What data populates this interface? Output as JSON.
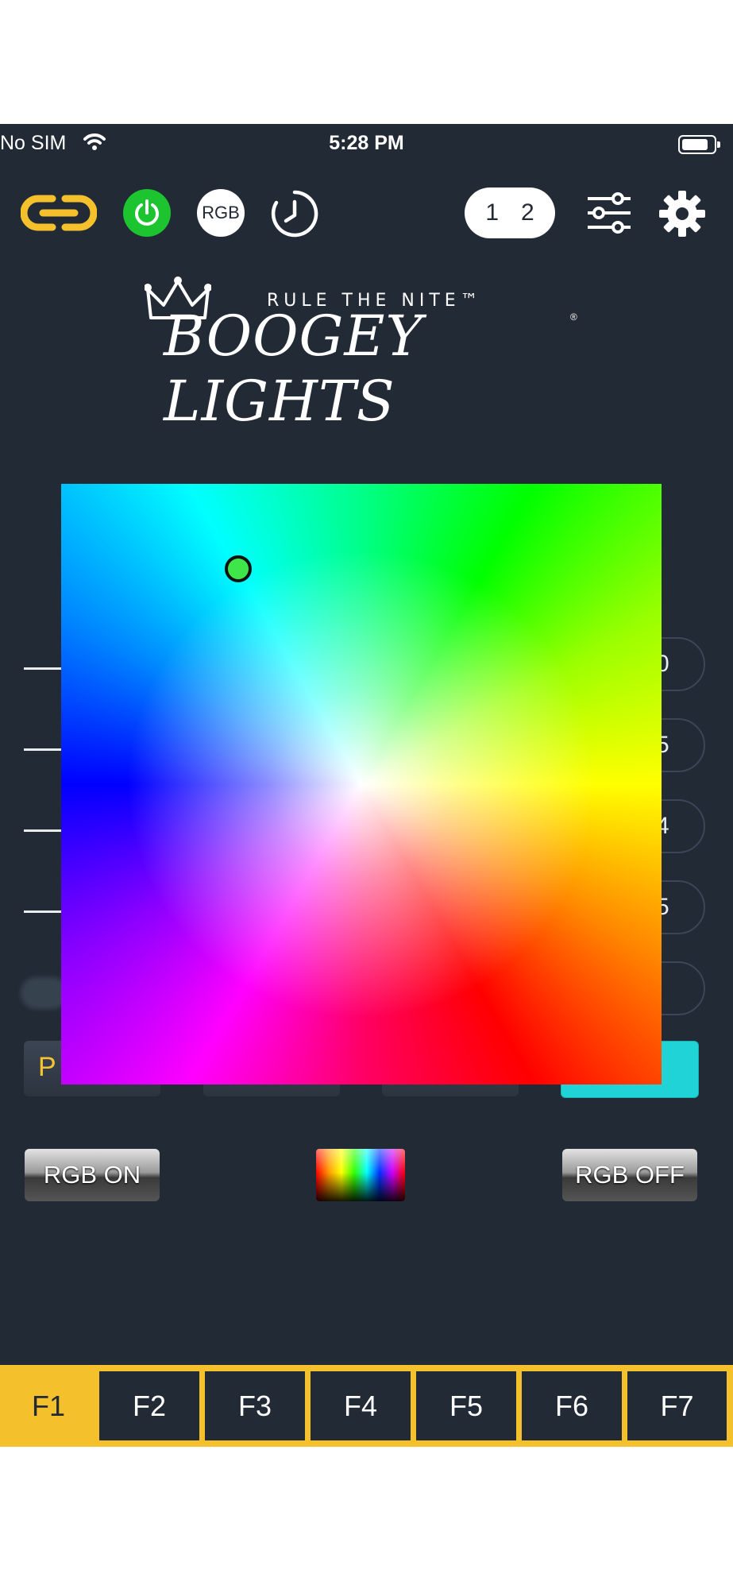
{
  "status_bar": {
    "carrier": "No SIM",
    "time": "5:28 PM",
    "battery_level": 0.85
  },
  "toolbar": {
    "rgb_label": "RGB",
    "channel_1": "1",
    "channel_2": "2",
    "icons": [
      "link-icon",
      "power-icon",
      "rgb-icon",
      "timer-icon",
      "sliders-icon",
      "gear-icon"
    ]
  },
  "logo": {
    "tagline": "RULE THE NITE™",
    "name": "BOOGEY LIGHTS",
    "registered": "®"
  },
  "background_fields": [
    "0",
    "5",
    "4",
    "5",
    ""
  ],
  "preset_button_text": "P",
  "buttons": {
    "rgb_on": "RGB ON",
    "rgb_off": "RGB OFF"
  },
  "tabs": [
    {
      "label": "F1",
      "active": true
    },
    {
      "label": "F2",
      "active": false
    },
    {
      "label": "F3",
      "active": false
    },
    {
      "label": "F4",
      "active": false
    },
    {
      "label": "F5",
      "active": false
    },
    {
      "label": "F6",
      "active": false
    },
    {
      "label": "F7",
      "active": false
    }
  ],
  "colors": {
    "background": "#222a36",
    "accent_yellow": "#f4c02c",
    "power_green": "#1cc52f",
    "cyan_active": "#1fd3d6",
    "selected_color": "#3fe64a"
  }
}
